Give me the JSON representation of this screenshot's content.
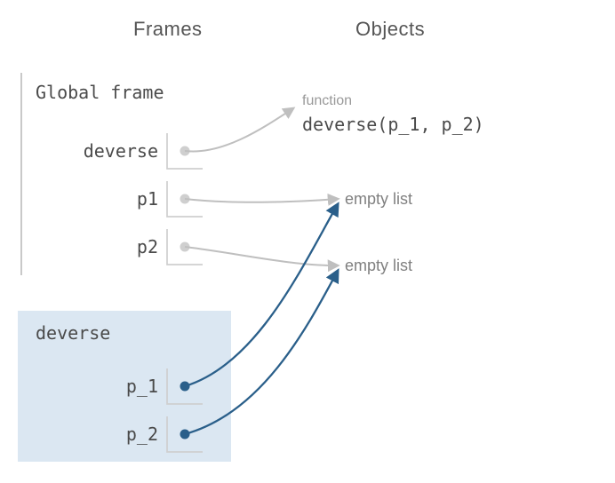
{
  "headers": {
    "frames": "Frames",
    "objects": "Objects"
  },
  "global_frame": {
    "title": "Global frame",
    "vars": {
      "deverse": "deverse",
      "p1": "p1",
      "p2": "p2"
    }
  },
  "local_frame": {
    "title": "deverse",
    "vars": {
      "p_1": "p_1",
      "p_2": "p_2"
    }
  },
  "objects": {
    "func_tag": "function",
    "func_sig": "deverse(p_1, p_2)",
    "empty1": "empty list",
    "empty2": "empty list"
  }
}
